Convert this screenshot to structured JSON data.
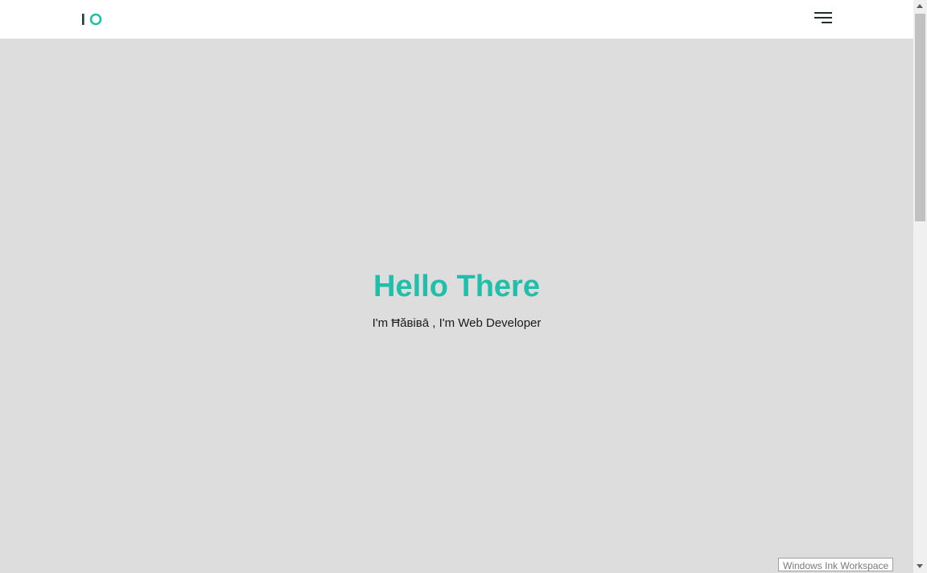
{
  "header": {
    "logo_name": "io-logo",
    "menu_icon": "hamburger-menu-icon"
  },
  "hero": {
    "title": "Hello There",
    "subtitle": "I'm Ħăвівā , I'm Web Developer"
  },
  "tooltip": {
    "text": "Windows Ink Workspace"
  },
  "colors": {
    "accent": "#1fbfaa",
    "background": "#dddddd",
    "header_bg": "#ffffff",
    "logo_dark": "#1f3a3a"
  }
}
